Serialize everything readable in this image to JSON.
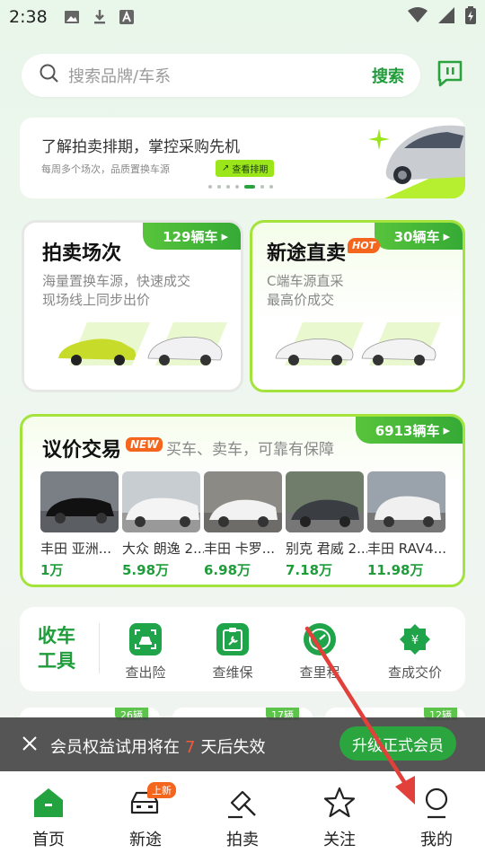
{
  "status": {
    "time": "2:38"
  },
  "search": {
    "placeholder": "搜索品牌/车系",
    "button": "搜索"
  },
  "banner": {
    "title": "了解拍卖排期，掌控采购先机",
    "subtitle": "每周多个场次，品质置换车源",
    "tag": "查看排期",
    "active_dot": 5,
    "dot_count": 7
  },
  "auction": {
    "title": "拍卖场次",
    "count": "129辆车",
    "desc1": "海量置换车源，快速成交",
    "desc2": "现场线上同步出价"
  },
  "direct": {
    "title": "新途直卖",
    "hot": "HOT",
    "count": "30辆车",
    "desc1": "C端车源直采",
    "desc2": "最高价成交"
  },
  "nego": {
    "title": "议价交易",
    "new": "NEW",
    "subtitle": "买车、卖车，可靠有保障",
    "count": "6913辆车",
    "cars": [
      {
        "name": "丰田 亚洲...",
        "price": "1万"
      },
      {
        "name": "大众 朗逸 2...",
        "price": "5.98万"
      },
      {
        "name": "丰田 卡罗...",
        "price": "6.98万"
      },
      {
        "name": "别克 君威 2...",
        "price": "7.18万"
      },
      {
        "name": "丰田 RAV4...",
        "price": "11.98万"
      }
    ]
  },
  "tools": {
    "label": "收车工具",
    "items": [
      {
        "label": "查出险"
      },
      {
        "label": "查维保"
      },
      {
        "label": "查里程"
      },
      {
        "label": "查成交价"
      }
    ]
  },
  "partial_tags": [
    "26辆",
    "17辆",
    "12辆"
  ],
  "toast": {
    "before": "会员权益试用将在",
    "days": "7",
    "after": "天后失效",
    "button": "升级正式会员"
  },
  "nav": {
    "items": [
      {
        "label": "首页"
      },
      {
        "label": "新途",
        "badge": "上新"
      },
      {
        "label": "拍卖"
      },
      {
        "label": "关注"
      },
      {
        "label": "我的"
      }
    ]
  },
  "colors": {
    "brand": "#1f9d3a",
    "lime": "#a4e33c",
    "accent": "#f4661d",
    "annotation_arrow": "#e2403a"
  }
}
